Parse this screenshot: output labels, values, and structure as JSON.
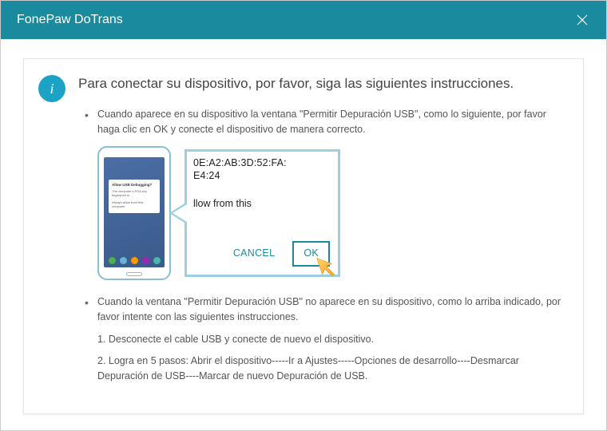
{
  "window": {
    "title": "FonePaw DoTrans"
  },
  "heading": "Para conectar su dispositivo, por favor, siga las siguientes instrucciones.",
  "bullet1": "Cuando aparece en su dispositivo la ventana \"Permitir Depuración USB\", como lo siguiente, por favor haga clic en OK y conecte el dispositivo de manera correcto.",
  "bullet2_intro": "Cuando la ventana \"Permitir Depuración USB\" no aparece en su dispositivo, como lo arriba indicado, por favor intente con las siguientes instrucciones.",
  "bullet2_step1": "1. Desconecte el cable USB y conecte de nuevo el dispositivo.",
  "bullet2_step2": "2. Logra en 5 pasos: Abrir el dispositivo-----Ir a Ajustes-----Opciones de desarrollo----Desmarcar Depuración de USB----Marcar de nuevo Depuración de USB.",
  "phone_dialog": {
    "title": "Allow USB Debugging?",
    "body": "The computer's RSA key fingerprint is:",
    "checkbox": "Always allow from this computer"
  },
  "detail": {
    "mac1": "0E:A2:AB:3D:52:FA:",
    "mac2": "E4:24",
    "allow": "llow from this",
    "cancel": "CANCEL",
    "ok": "OK"
  }
}
